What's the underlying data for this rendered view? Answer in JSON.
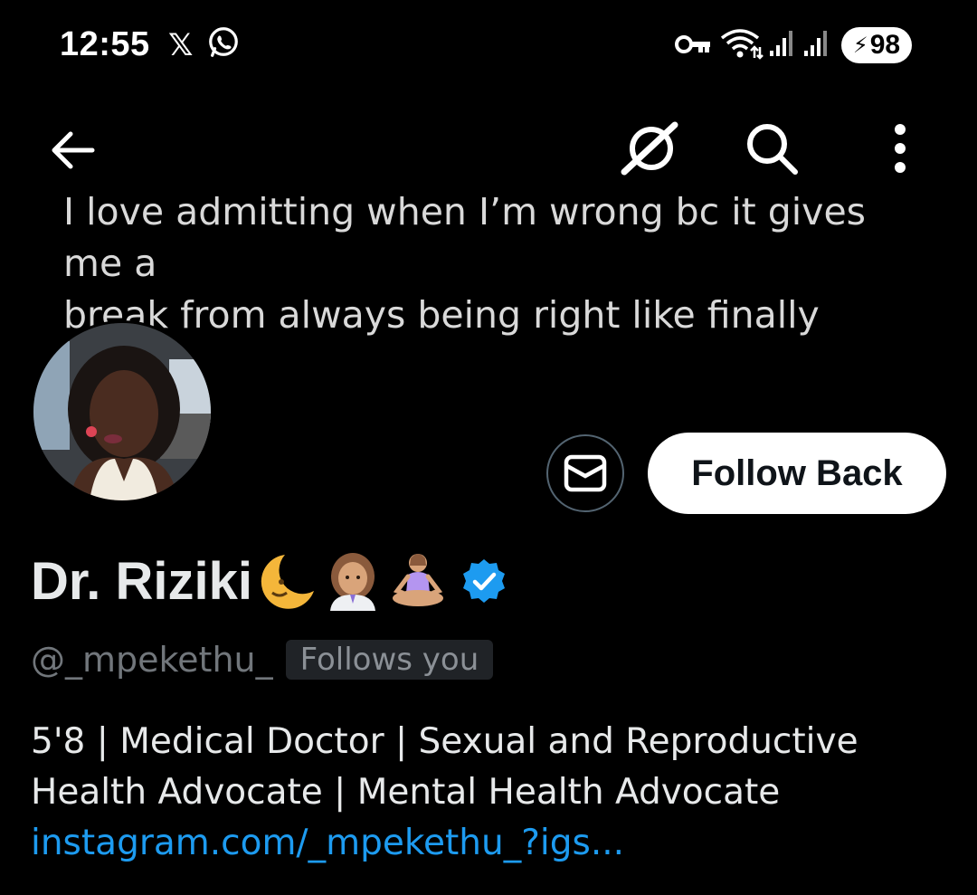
{
  "status_bar": {
    "time": "12:55",
    "x_notification_glyph": "𝕏",
    "battery_level": "98",
    "icons": [
      "x-icon",
      "whatsapp-icon",
      "vpn-key-icon",
      "wifi-icon",
      "signal-icon",
      "signal-icon",
      "battery-charging-icon"
    ]
  },
  "header": {
    "icons": [
      "back-arrow-icon",
      "grok-icon",
      "search-icon",
      "more-vertical-icon"
    ]
  },
  "banner": {
    "text_line1": "I love admitting when I’m wrong bc it gives me a",
    "text_line2": "break from always being right like finally"
  },
  "profile": {
    "display_name": "Dr. Riziki",
    "name_emojis": [
      "🌜",
      "👩🏽‍⚕️",
      "🧘🏽‍♀️"
    ],
    "verified": true,
    "handle": "@_mpekethu_",
    "follows_you_label": "Follows you",
    "bio_line1": "5'8 | Medical Doctor | Sexual and Reproductive",
    "bio_line2": "Health Advocate | Mental Health Advocate",
    "link_text": "instagram.com/_mpekethu_?igs..."
  },
  "actions": {
    "follow_back_label": "Follow Back",
    "message_icon": "envelope-icon"
  },
  "colors": {
    "background": "#000000",
    "primary_text": "#e7e9ea",
    "secondary_text": "#71767b",
    "link": "#1d9bf0",
    "verified_badge": "#1d9bf0",
    "button_bg": "#ffffff"
  }
}
